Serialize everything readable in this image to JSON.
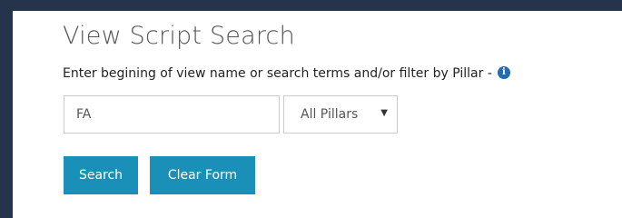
{
  "panel": {
    "title": "View Script Search",
    "instructions": "Enter begining of view name or search terms and/or filter by Pillar -",
    "info_icon": "info-icon",
    "search_input": {
      "value": "FA",
      "placeholder": ""
    },
    "pillar_select": {
      "selected": "All Pillars",
      "icon": "chevron-down-icon"
    },
    "buttons": {
      "search_label": "Search",
      "clear_label": "Clear Form"
    }
  },
  "colors": {
    "frame": "#25344a",
    "button": "#1a8fb8",
    "info_icon": "#1f6eb3"
  }
}
